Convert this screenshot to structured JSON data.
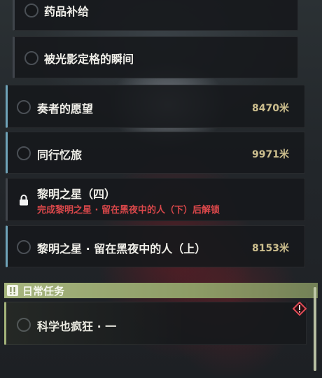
{
  "quests": [
    {
      "title": "药品补给",
      "distance": ""
    },
    {
      "title": "被光影定格的瞬间",
      "distance": ""
    },
    {
      "title": "奏者的愿望",
      "distance": "8470米"
    },
    {
      "title": "同行忆旅",
      "distance": "9971米"
    },
    {
      "title": "黎明之星（四）",
      "lock_message": "完成黎明之星 · 留在黑夜中的人（下）后解锁"
    },
    {
      "title": "黎明之星 · 留在黑夜中的人（上）",
      "distance": "8153米"
    }
  ],
  "daily_section": {
    "title": "日常任务",
    "icon": "exclamation-icon",
    "items": [
      {
        "title": "科学也疯狂 · 一",
        "icon": "warning-diamond-icon"
      }
    ]
  },
  "colors": {
    "distance": "#cdbf8e",
    "locked_text": "#d9474a",
    "section_bar": "#a6b57e",
    "active_accent": "#6fa3b8"
  }
}
